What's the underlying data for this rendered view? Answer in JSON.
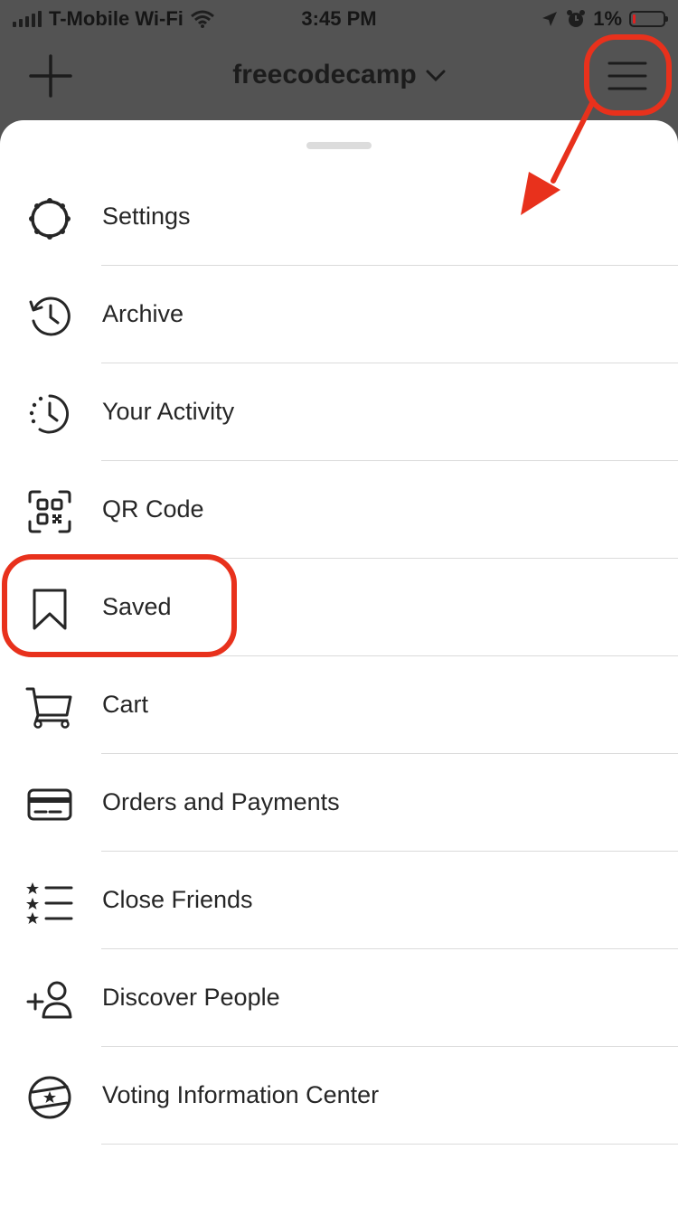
{
  "status_bar": {
    "carrier": "T-Mobile Wi-Fi",
    "time": "3:45 PM",
    "battery_percent": "1%"
  },
  "header": {
    "username": "freecodecamp",
    "icons": [
      "plus-icon",
      "chevron-down-icon",
      "hamburger-menu-icon"
    ]
  },
  "menu": {
    "items": [
      {
        "label": "Settings",
        "icon": "settings-gear-icon"
      },
      {
        "label": "Archive",
        "icon": "archive-clock-icon"
      },
      {
        "label": "Your Activity",
        "icon": "activity-clock-icon"
      },
      {
        "label": "QR Code",
        "icon": "qr-code-icon"
      },
      {
        "label": "Saved",
        "icon": "bookmark-icon"
      },
      {
        "label": "Cart",
        "icon": "cart-icon"
      },
      {
        "label": "Orders and Payments",
        "icon": "credit-card-icon"
      },
      {
        "label": "Close Friends",
        "icon": "star-list-icon"
      },
      {
        "label": "Discover People",
        "icon": "add-person-icon"
      },
      {
        "label": "Voting Information Center",
        "icon": "voting-icon"
      }
    ]
  },
  "annotations": {
    "color": "#e8311c",
    "highlighted": [
      "hamburger-menu",
      "Saved"
    ]
  },
  "colors": {
    "overlay": "#535353",
    "sheet": "#ffffff",
    "text": "#262626",
    "divider": "#dbdbdb"
  }
}
